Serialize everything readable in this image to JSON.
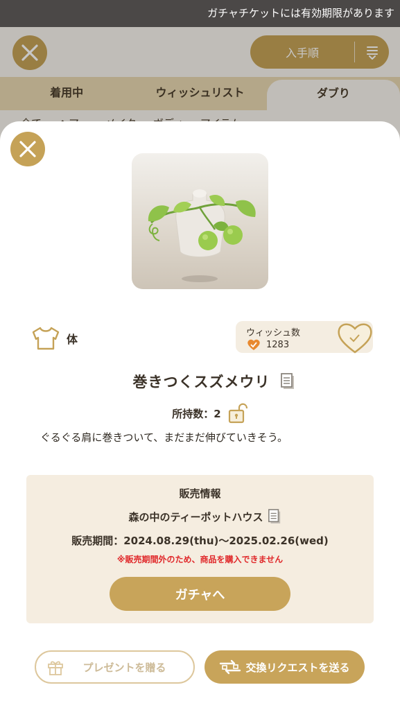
{
  "ticker": {
    "text": "ガチャチケットには有効期限があります"
  },
  "background": {
    "sort_label": "入手順",
    "tabs": [
      {
        "label": "着用中"
      },
      {
        "label": "ウィッシュリスト"
      },
      {
        "label": "ダブり"
      }
    ],
    "active_tab": "ダブり",
    "subtabs": [
      {
        "label": "全て"
      },
      {
        "label": "ヘアー"
      },
      {
        "label": "メイク"
      },
      {
        "label": "ボディ"
      },
      {
        "label": "アイテム"
      }
    ]
  },
  "item": {
    "category": "体",
    "name": "巻きつくスズメウリ",
    "owned_label": "所持数：2",
    "description": "ぐるぐる肩に巻きついて、まだまだ伸びていきそう。",
    "wish": {
      "title": "ウィッシュ数",
      "count": "1283"
    }
  },
  "sales": {
    "title": "販売情報",
    "source": "森の中のティーポットハウス",
    "period": "販売期間：2024.08.29(thu)〜2025.02.26(wed)",
    "warning": "※販売期間外のため、商品を購入できません",
    "gacha_button": "ガチャへ"
  },
  "actions": {
    "present_button": "プレゼントを贈る",
    "exchange_button": "交換リクエストを送る"
  },
  "icons": {
    "close": "close-icon",
    "sort": "sort-icon",
    "shirt": "shirt-icon",
    "heart": "heart-icon",
    "copy": "copy-icon",
    "lock": "unlock-icon",
    "gift": "gift-icon",
    "exchange": "exchange-icon"
  },
  "colors": {
    "accent": "#c5a257",
    "warning": "#e0282a",
    "panel": "#f5ede0",
    "wish_badge": "#e8892f"
  }
}
